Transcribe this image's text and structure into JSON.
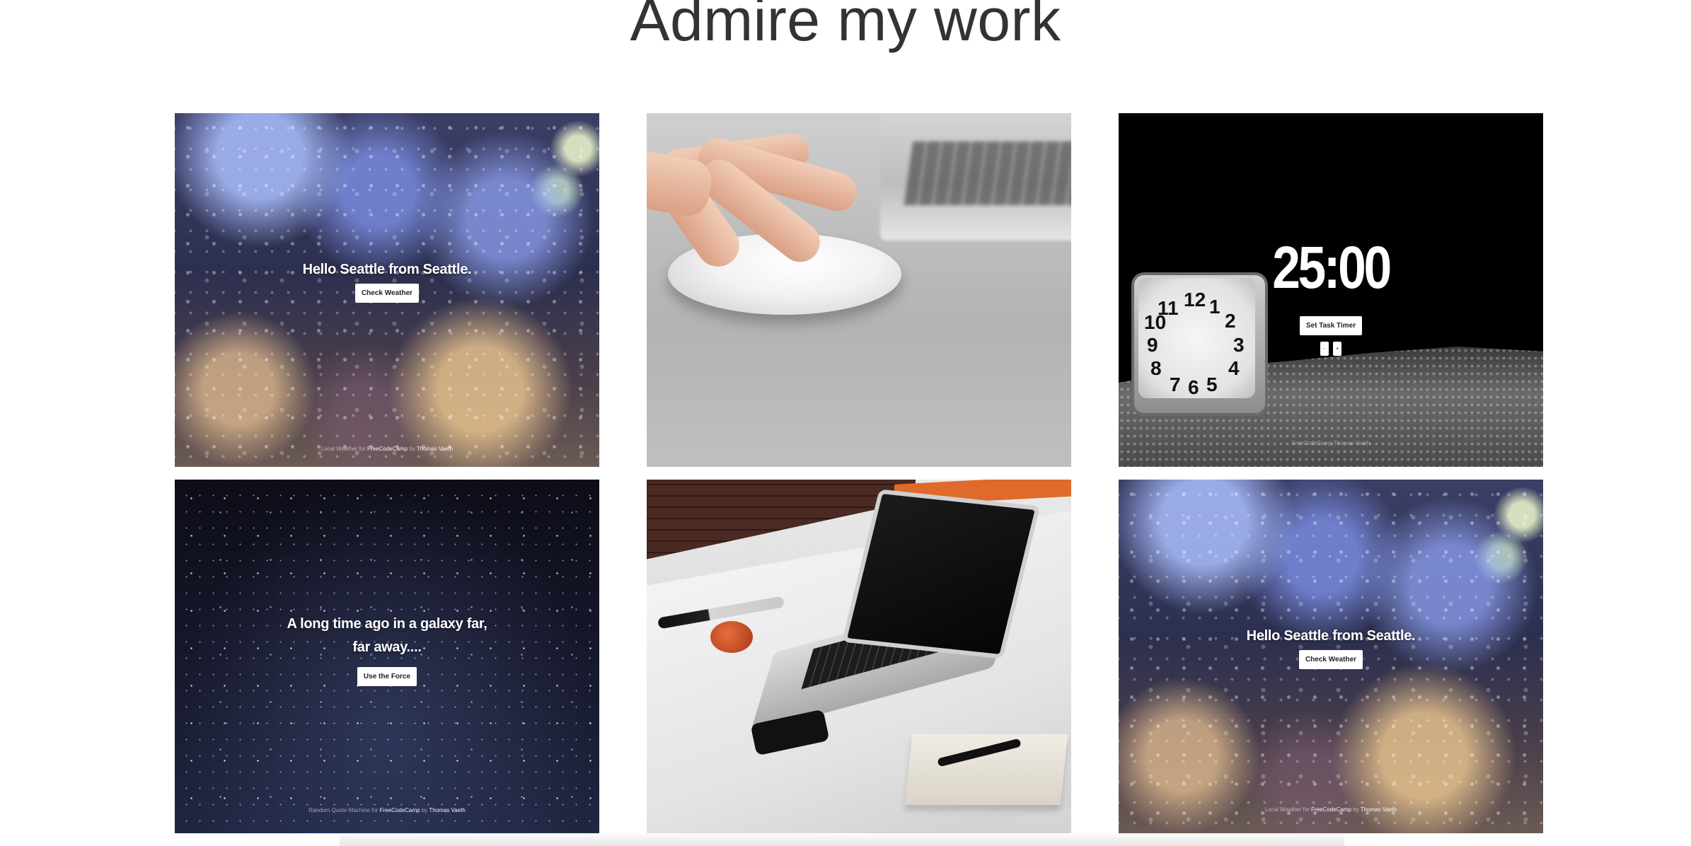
{
  "page": {
    "title": "Admire my work"
  },
  "portfolio": {
    "items": [
      {
        "heading": "Hello Seattle from Seattle.",
        "button": "Check Weather",
        "credit_prefix": "Local Weather for",
        "credit_site": "FreeCodeCamp",
        "credit_by": "by",
        "credit_author": "Thomas Vaeth"
      },
      {
        "image": "hand-on-mouse"
      },
      {
        "timer": "25:00",
        "button": "Set Task Timer",
        "minus": "-",
        "plus": "+",
        "credit_site": "FreeCodeCamp",
        "credit_author": "Thomas Vaeth"
      },
      {
        "heading_line1": "A long time ago in a galaxy far,",
        "heading_line2": "far away....",
        "button": "Use the Force",
        "credit_prefix": "Random Quote Machine for",
        "credit_site": "FreeCodeCamp",
        "credit_by": "by",
        "credit_author": "Thomas Vaeth"
      },
      {
        "image": "laptop-on-desk"
      },
      {
        "heading": "Hello Seattle from Seattle.",
        "button": "Check Weather",
        "credit_prefix": "Local Weather for",
        "credit_site": "FreeCodeCamp",
        "credit_by": "by",
        "credit_author": "Thomas Vaeth"
      }
    ]
  }
}
